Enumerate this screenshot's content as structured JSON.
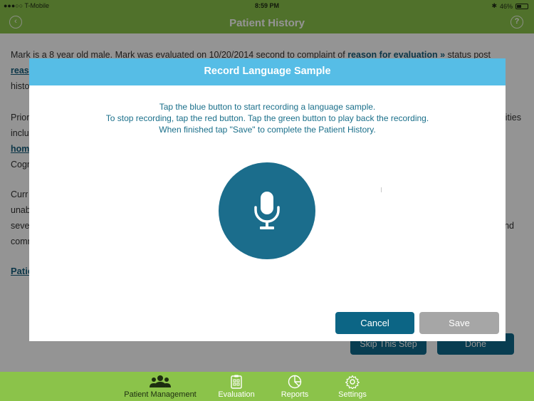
{
  "status_bar": {
    "carrier": "●●●○○ T-Mobile",
    "time": "8:59 PM",
    "battery": "46%"
  },
  "header": {
    "back_icon": "chevron-left-icon",
    "title": "Patient History",
    "help_icon": "question-circle-icon",
    "back_glyph": "‹",
    "help_glyph": "?"
  },
  "background": {
    "line1_a": "Mark is a 8 year old male. Mark was evaluated on 10/20/2014 second to complaint of ",
    "line1_link": "reason for evaluation »",
    "line1_b": " status post",
    "line2_link": "reas",
    "line3": "histo",
    "line4_a": "Prior",
    "line4_b": "ities",
    "line5": "inclu",
    "line6_link": "hom",
    "line7": "Cogn",
    "line8": "Curr",
    "line9": "unab",
    "line10_a": "seve",
    "line10_b": "nd",
    "line11": "comm",
    "line12_link": "Patie",
    "skip_button": "Skip This Step",
    "done_button": "Done"
  },
  "modal": {
    "title": "Record Language Sample",
    "instruction_1": "Tap the blue button to start recording a language sample.",
    "instruction_2": "To stop recording, tap the red button. Tap the green button to play back the recording.",
    "instruction_3": "When finished tap \"Save\" to complete the Patient History.",
    "record_icon": "microphone-icon",
    "cancel_label": "Cancel",
    "save_label": "Save"
  },
  "tabbar": {
    "items": [
      {
        "label": "Patient Management",
        "icon": "people-icon",
        "active": true
      },
      {
        "label": "Evaluation",
        "icon": "clipboard-icon",
        "active": false
      },
      {
        "label": "Reports",
        "icon": "pie-chart-icon",
        "active": false
      },
      {
        "label": "Settings",
        "icon": "gear-icon",
        "active": false
      }
    ]
  },
  "colors": {
    "brand_green": "#8bc34a",
    "modal_header": "#56bde6",
    "primary_blue": "#0c6585",
    "mic_button": "#1b6d8c",
    "disabled_gray": "#a6a6a6"
  }
}
